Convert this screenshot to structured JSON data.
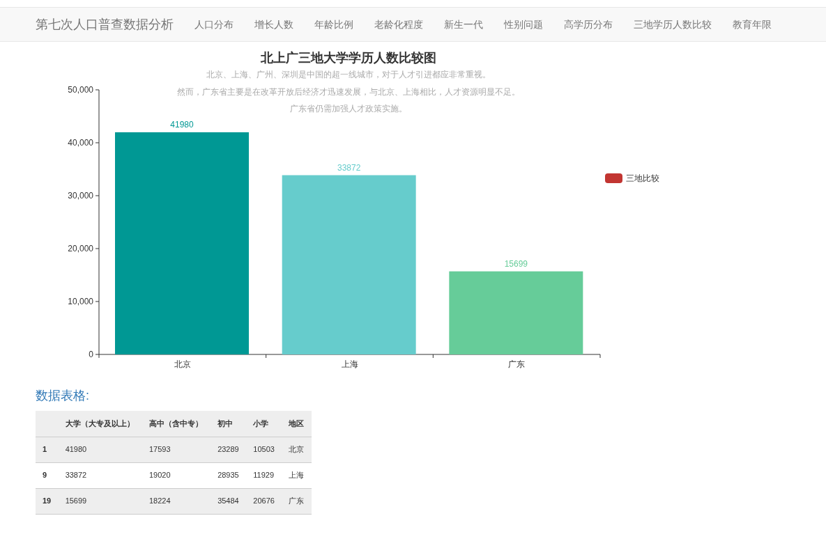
{
  "navbar": {
    "brand": "第七次人口普查数据分析",
    "items": [
      {
        "label": "人口分布",
        "selected": false
      },
      {
        "label": "增长人数",
        "selected": false
      },
      {
        "label": "年龄比例",
        "selected": false
      },
      {
        "label": "老龄化程度",
        "selected": false
      },
      {
        "label": "新生一代",
        "selected": false
      },
      {
        "label": "性别问题",
        "selected": false
      },
      {
        "label": "高学历分布",
        "selected": false
      },
      {
        "label": "三地学历人数比较",
        "selected": false
      },
      {
        "label": "教育年限",
        "selected": false
      }
    ]
  },
  "chart": {
    "bars": [
      {
        "color": "#009894"
      },
      {
        "color": "#66cccc"
      },
      {
        "color": "#66cc99"
      }
    ],
    "legend": {
      "color": "#c23531"
    },
    "subtitle": [
      "北京、上海、广州、深圳是中国的超一线城市，对于人才引进都应非常重视。",
      "然而，广东省主要是在改革开放后经济才迅速发展，与北京、上海相比，人才资源明显不足。",
      "广东省仍需加强人才政策实施。"
    ],
    "chart_data": {
      "type": "bar",
      "title": "北上广三地大学学历人数比较图",
      "categories": [
        "北京",
        "上海",
        "广东"
      ],
      "series": [
        {
          "name": "三地比较",
          "values": [
            41980,
            33872,
            15699
          ]
        }
      ],
      "ylim": [
        0,
        50000
      ],
      "yticks": [
        {
          "value": 0,
          "label": "0"
        },
        {
          "value": 10000,
          "label": "10,000"
        },
        {
          "value": 20000,
          "label": "20,000"
        },
        {
          "value": 30000,
          "label": "30,000"
        },
        {
          "value": 40000,
          "label": "40,000"
        },
        {
          "value": 50000,
          "label": "50,000"
        }
      ],
      "data_labels": true
    }
  },
  "table": {
    "heading": "数据表格:",
    "columns": [
      "",
      "大学（大专及以上）",
      "高中（含中专）",
      "初中",
      "小学",
      "地区"
    ],
    "rows": [
      [
        "1",
        "41980",
        "17593",
        "23289",
        "10503",
        "北京"
      ],
      [
        "9",
        "33872",
        "19020",
        "28935",
        "11929",
        "上海"
      ],
      [
        "19",
        "15699",
        "18224",
        "35484",
        "20676",
        "广东"
      ]
    ]
  }
}
